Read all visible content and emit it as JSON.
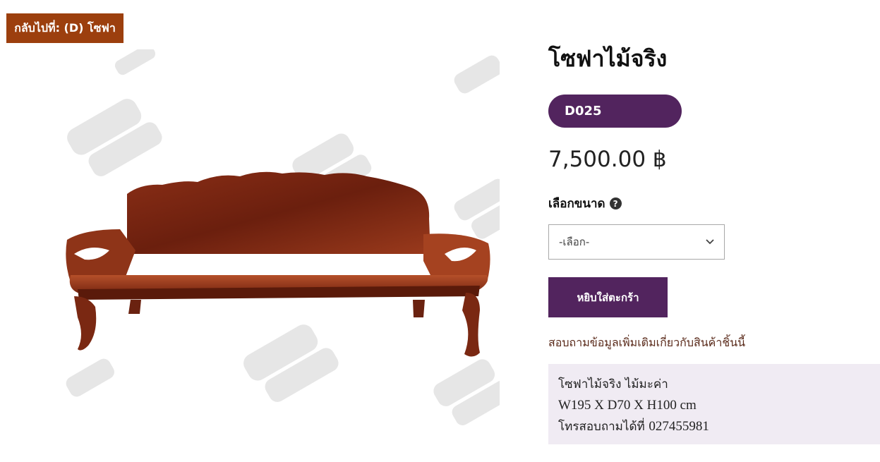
{
  "back_button": {
    "label": "กลับไปที่: (D) โซฟา"
  },
  "product": {
    "title": "โซฟาไม้จริง",
    "sku": "D025",
    "price": "7,500.00 ฿",
    "size_label": "เลือกขนาด",
    "help_icon_glyph": "?",
    "select": {
      "selected": "-เลือก-"
    },
    "add_to_cart": "หยิบใส่ตะกร้า",
    "inquiry_link": "สอบถามข้อมูลเพิ่มเติมเกี่ยวกับสินค้าชิ้นนี้",
    "description": {
      "line1": "โซฟาไม้จริง ไม้มะค่า",
      "line2": "W195 X D70 X H100 cm",
      "line3_label": "โทรสอบถามได้ที่",
      "line3_phone": "027455981"
    }
  },
  "icons": {
    "help": "question-circle-icon",
    "select_arrow": "chevron-down-icon"
  },
  "colors": {
    "back_button": "#9c3f0e",
    "accent_purple": "#52245e",
    "description_bg": "#f0ebf3"
  }
}
